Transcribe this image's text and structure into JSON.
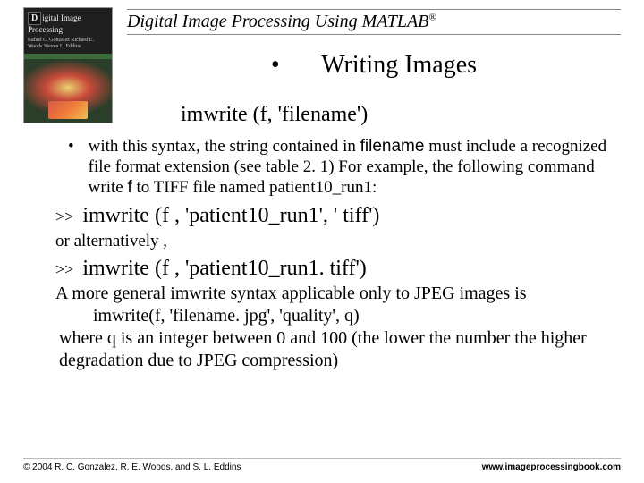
{
  "cover": {
    "top_line1_prefix": "D",
    "top_line1_rest": "igital Image",
    "top_line2": "Processing",
    "authors": "Rafael C. Gonzalez\nRichard E. Woods\nSteven L. Eddins"
  },
  "header": {
    "title_main": "Digital Image Processing Using MATLAB",
    "title_reg": "®"
  },
  "section": {
    "bullet": "•",
    "heading": "Writing Images",
    "syntax": "imwrite (f, 'filename')"
  },
  "bullet1": {
    "dot": "•",
    "text_pre": "with this syntax, the string contained in ",
    "text_kw": "filename",
    "text_mid": " must include a recognized file format extension (see table 2. 1) For example, the following command write ",
    "text_kw2": "f",
    "text_post": " to TIFF file named patient10_run1:"
  },
  "cmd1": {
    "prompt": ">>",
    "code": "imwrite (f , 'patient10_run1', ' tiff')"
  },
  "alt": "or alternatively ,",
  "cmd2": {
    "prompt": ">>",
    "code": "imwrite (f , 'patient10_run1. tiff')"
  },
  "general": {
    "line1": "A more general imwrite syntax applicable only to JPEG images is",
    "line2": "imwrite(f, 'filename. jpg', 'quality', q)",
    "line3": "where q is an integer between 0 and 100 (the lower the number the higher degradation due to JPEG compression)"
  },
  "footer": {
    "left": "© 2004 R. C. Gonzalez, R. E. Woods, and S. L. Eddins",
    "right": "www.imageprocessingbook.com"
  }
}
